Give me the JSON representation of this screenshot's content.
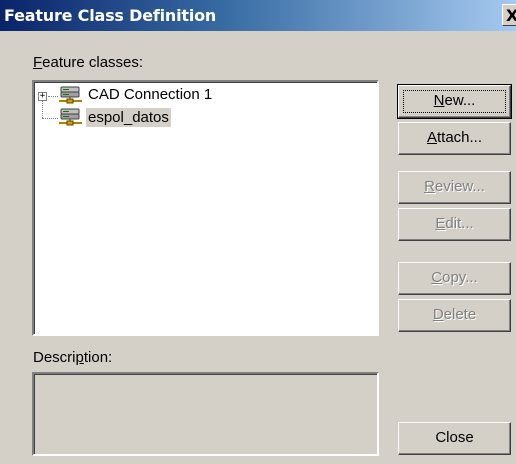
{
  "window": {
    "title": "Feature Class Definition",
    "close_glyph": "X"
  },
  "feature_classes": {
    "label_underline": "F",
    "label_rest": "eature classes:",
    "items": [
      {
        "label": "CAD Connection 1",
        "icon": "server-connection-icon",
        "expandable": true
      },
      {
        "label": "espol_datos",
        "icon": "server-connection-icon",
        "expandable": false,
        "selected": true
      }
    ]
  },
  "description": {
    "label_pre": "Descri",
    "label_underline": "p",
    "label_post": "tion:",
    "value": ""
  },
  "buttons": {
    "new": {
      "ul": "N",
      "rest": "ew...",
      "enabled": true
    },
    "attach": {
      "ul": "A",
      "rest": "ttach...",
      "enabled": true
    },
    "review": {
      "ul": "R",
      "rest": "eview...",
      "enabled": false
    },
    "edit": {
      "ul": "E",
      "rest": "dit...",
      "enabled": false
    },
    "copy": {
      "ul": "C",
      "rest": "opy...",
      "enabled": false
    },
    "delete": {
      "ul": "D",
      "rest": "elete",
      "enabled": false
    },
    "close": {
      "label": "Close",
      "enabled": true
    }
  },
  "colors": {
    "title_bar_start": "#0a246a",
    "title_bar_end": "#a6caf0",
    "dialog_face": "#d4d0c8"
  }
}
